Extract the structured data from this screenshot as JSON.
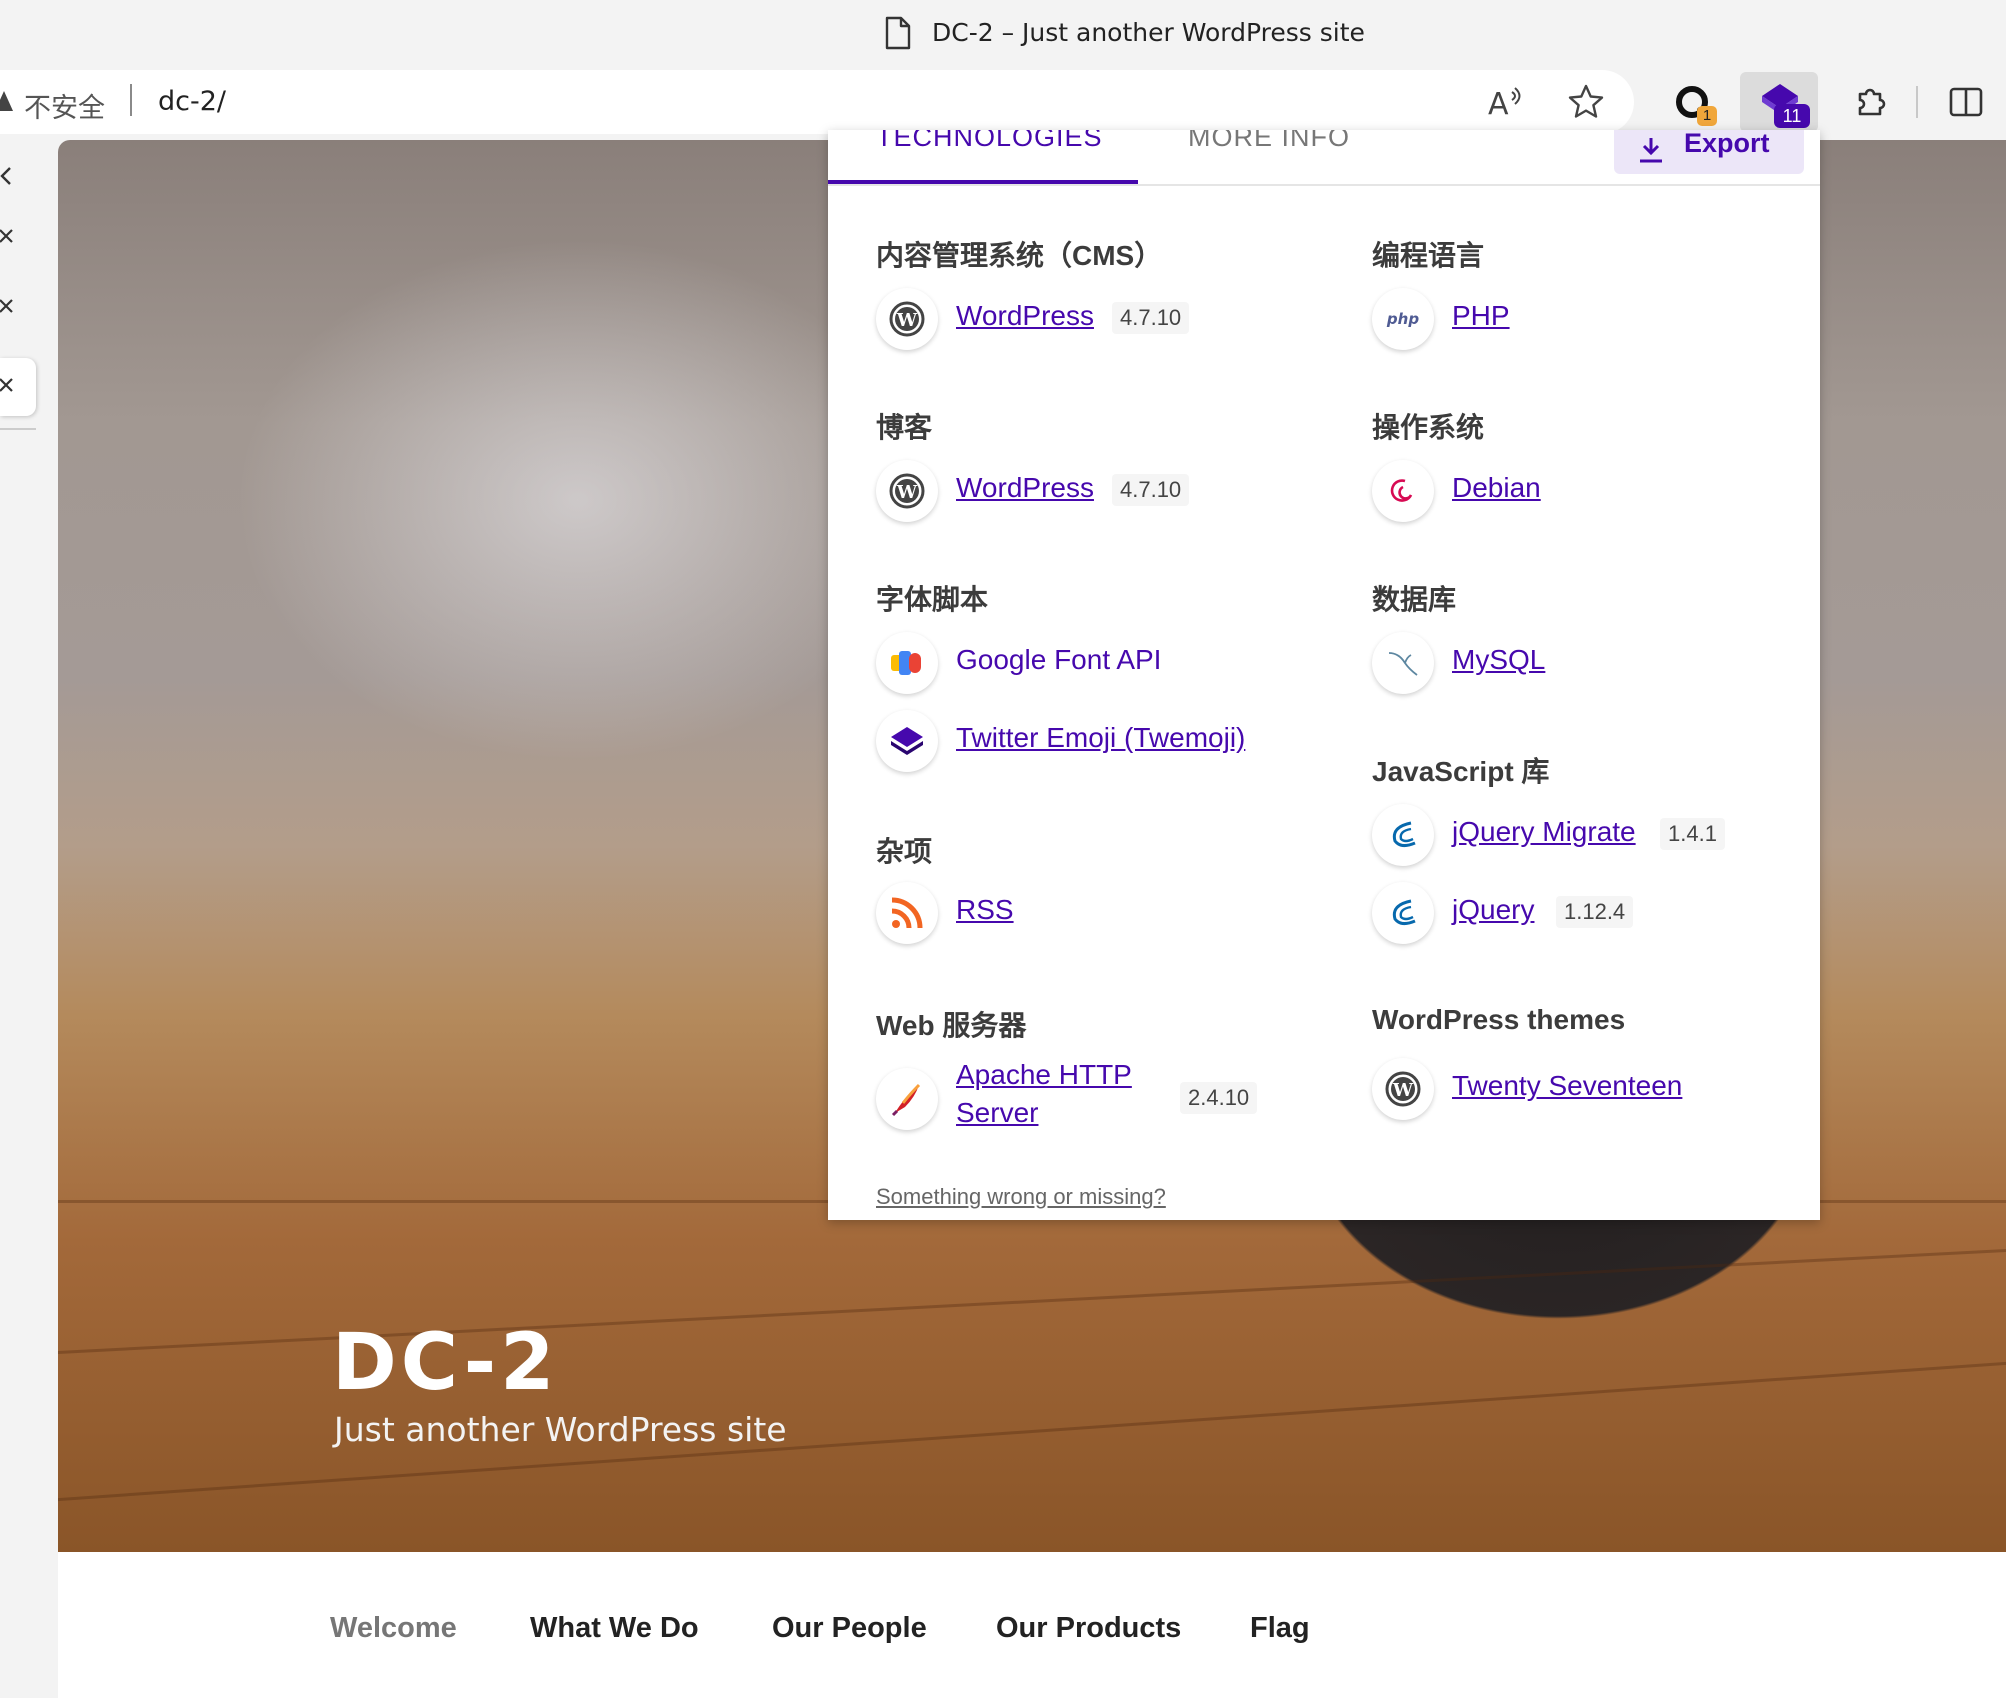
{
  "browser": {
    "window_title": "DC-2 – Just another WordPress site",
    "security_label": "不安全",
    "url": "dc-2/",
    "extension1_badge": "1",
    "extension2_badge": "11"
  },
  "popup": {
    "tabs": [
      "TECHNOLOGIES",
      "MORE INFO"
    ],
    "export_label": "Export",
    "left_column": [
      {
        "heading": "内容管理系统（CMS）",
        "items": [
          {
            "name": "WordPress",
            "version": "4.7.10",
            "icon": "wordpress-icon"
          }
        ]
      },
      {
        "heading": "博客",
        "items": [
          {
            "name": "WordPress",
            "version": "4.7.10",
            "icon": "wordpress-icon"
          }
        ]
      },
      {
        "heading": "字体脚本",
        "items": [
          {
            "name": "Google Font API",
            "version": "",
            "icon": "google-font-icon"
          },
          {
            "name": "Twitter Emoji (Twemoji)",
            "version": "",
            "icon": "twemoji-icon"
          }
        ]
      },
      {
        "heading": "杂项",
        "items": [
          {
            "name": "RSS",
            "version": "",
            "icon": "rss-icon"
          }
        ]
      },
      {
        "heading": "Web 服务器",
        "items": [
          {
            "name": "Apache HTTP Server",
            "version": "2.4.10",
            "icon": "apache-icon"
          }
        ]
      }
    ],
    "right_column": [
      {
        "heading": "编程语言",
        "items": [
          {
            "name": "PHP",
            "version": "",
            "icon": "php-icon"
          }
        ]
      },
      {
        "heading": "操作系统",
        "items": [
          {
            "name": "Debian",
            "version": "",
            "icon": "debian-icon"
          }
        ]
      },
      {
        "heading": "数据库",
        "items": [
          {
            "name": "MySQL",
            "version": "",
            "icon": "mysql-icon"
          }
        ]
      },
      {
        "heading": "JavaScript 库",
        "items": [
          {
            "name": "jQuery Migrate",
            "version": "1.4.1",
            "icon": "jquery-icon"
          },
          {
            "name": "jQuery",
            "version": "1.12.4",
            "icon": "jquery-icon"
          }
        ]
      },
      {
        "heading": "WordPress themes",
        "items": [
          {
            "name": "Twenty Seventeen",
            "version": "",
            "icon": "wordpress-icon"
          }
        ]
      }
    ],
    "apache_name_line1": "Apache HTTP",
    "apache_name_line2": "Server",
    "report_link": "Something wrong or missing?"
  },
  "site": {
    "title": "DC-2",
    "description": "Just another WordPress site",
    "nav": [
      "Welcome",
      "What We Do",
      "Our People",
      "Our Products",
      "Flag"
    ]
  },
  "colors": {
    "accent": "#4608ad",
    "badge_orange": "#f0a63a"
  }
}
